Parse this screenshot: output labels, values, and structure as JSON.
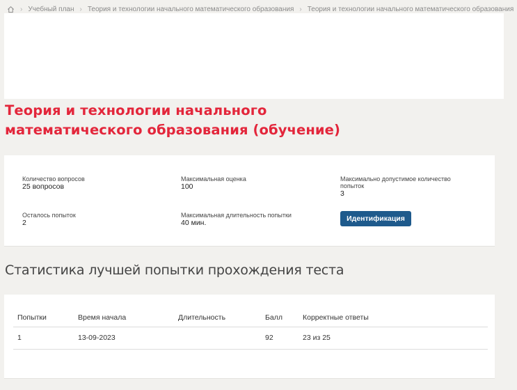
{
  "breadcrumb": {
    "items": [
      "Учебный план",
      "Теория и технологии начального математического образования",
      "Теория и технологии начального математического образования"
    ]
  },
  "page": {
    "title_line1": "Теория и технологии начального",
    "title_line2": "математического образования (обучение)",
    "accent_color": "#e3263b"
  },
  "info": {
    "questions_label": "Количество вопросов",
    "questions_value": "25 вопросов",
    "max_score_label": "Максимальная оценка",
    "max_score_value": "100",
    "max_attempts_label": "Максимально допустимое количество попыток",
    "max_attempts_value": "3",
    "remaining_label": "Осталось попыток",
    "remaining_value": "2",
    "duration_label": "Максимальная длительность попытки",
    "duration_value": "40 мин.",
    "ident_button": "Идентификация",
    "button_color": "#1e5a8c"
  },
  "stats": {
    "title": "Статистика лучшей попытки прохождения теста",
    "headers": [
      "Попытки",
      "Время начала",
      "Длительность",
      "Балл",
      "Корректные ответы"
    ],
    "rows": [
      [
        "1",
        "13-09-2023",
        "",
        "92",
        "23 из 25"
      ]
    ]
  }
}
